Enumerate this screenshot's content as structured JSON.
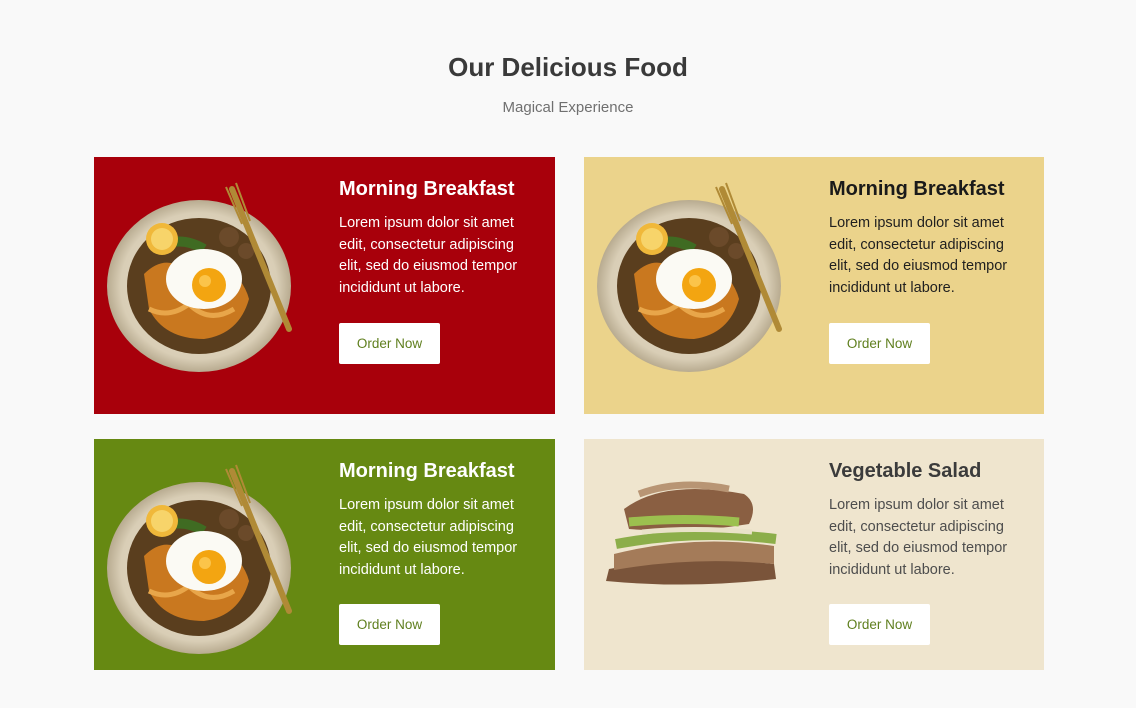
{
  "section": {
    "title": "Our Delicious Food",
    "subtitle": "Magical Experience"
  },
  "cards": [
    {
      "title": "Morning Breakfast",
      "text": "Lorem ipsum dolor sit amet edit, consectetur adipiscing elit, sed do eiusmod tempor incididunt ut labore.",
      "button": "Order Now",
      "background": "#a8000b",
      "image": "breakfast-plate"
    },
    {
      "title": "Morning Breakfast",
      "text": "Lorem ipsum dolor sit amet edit, consectetur adipiscing elit, sed do eiusmod tempor incididunt ut labore.",
      "button": "Order Now",
      "background": "#ebd38b",
      "image": "breakfast-plate"
    },
    {
      "title": "Morning Breakfast",
      "text": "Lorem ipsum dolor sit amet edit, consectetur adipiscing elit, sed do eiusmod tempor incididunt ut labore.",
      "button": "Order Now",
      "background": "#668912",
      "image": "breakfast-plate"
    },
    {
      "title": "Vegetable Salad",
      "text": "Lorem ipsum dolor sit amet edit, consectetur adipiscing elit, sed do eiusmod tempor incididunt ut labore.",
      "button": "Order Now",
      "background": "#efe5ce",
      "image": "sandwich"
    }
  ],
  "colors": {
    "page_background": "#f9f9f9",
    "button_text": "#5f7f1e"
  }
}
